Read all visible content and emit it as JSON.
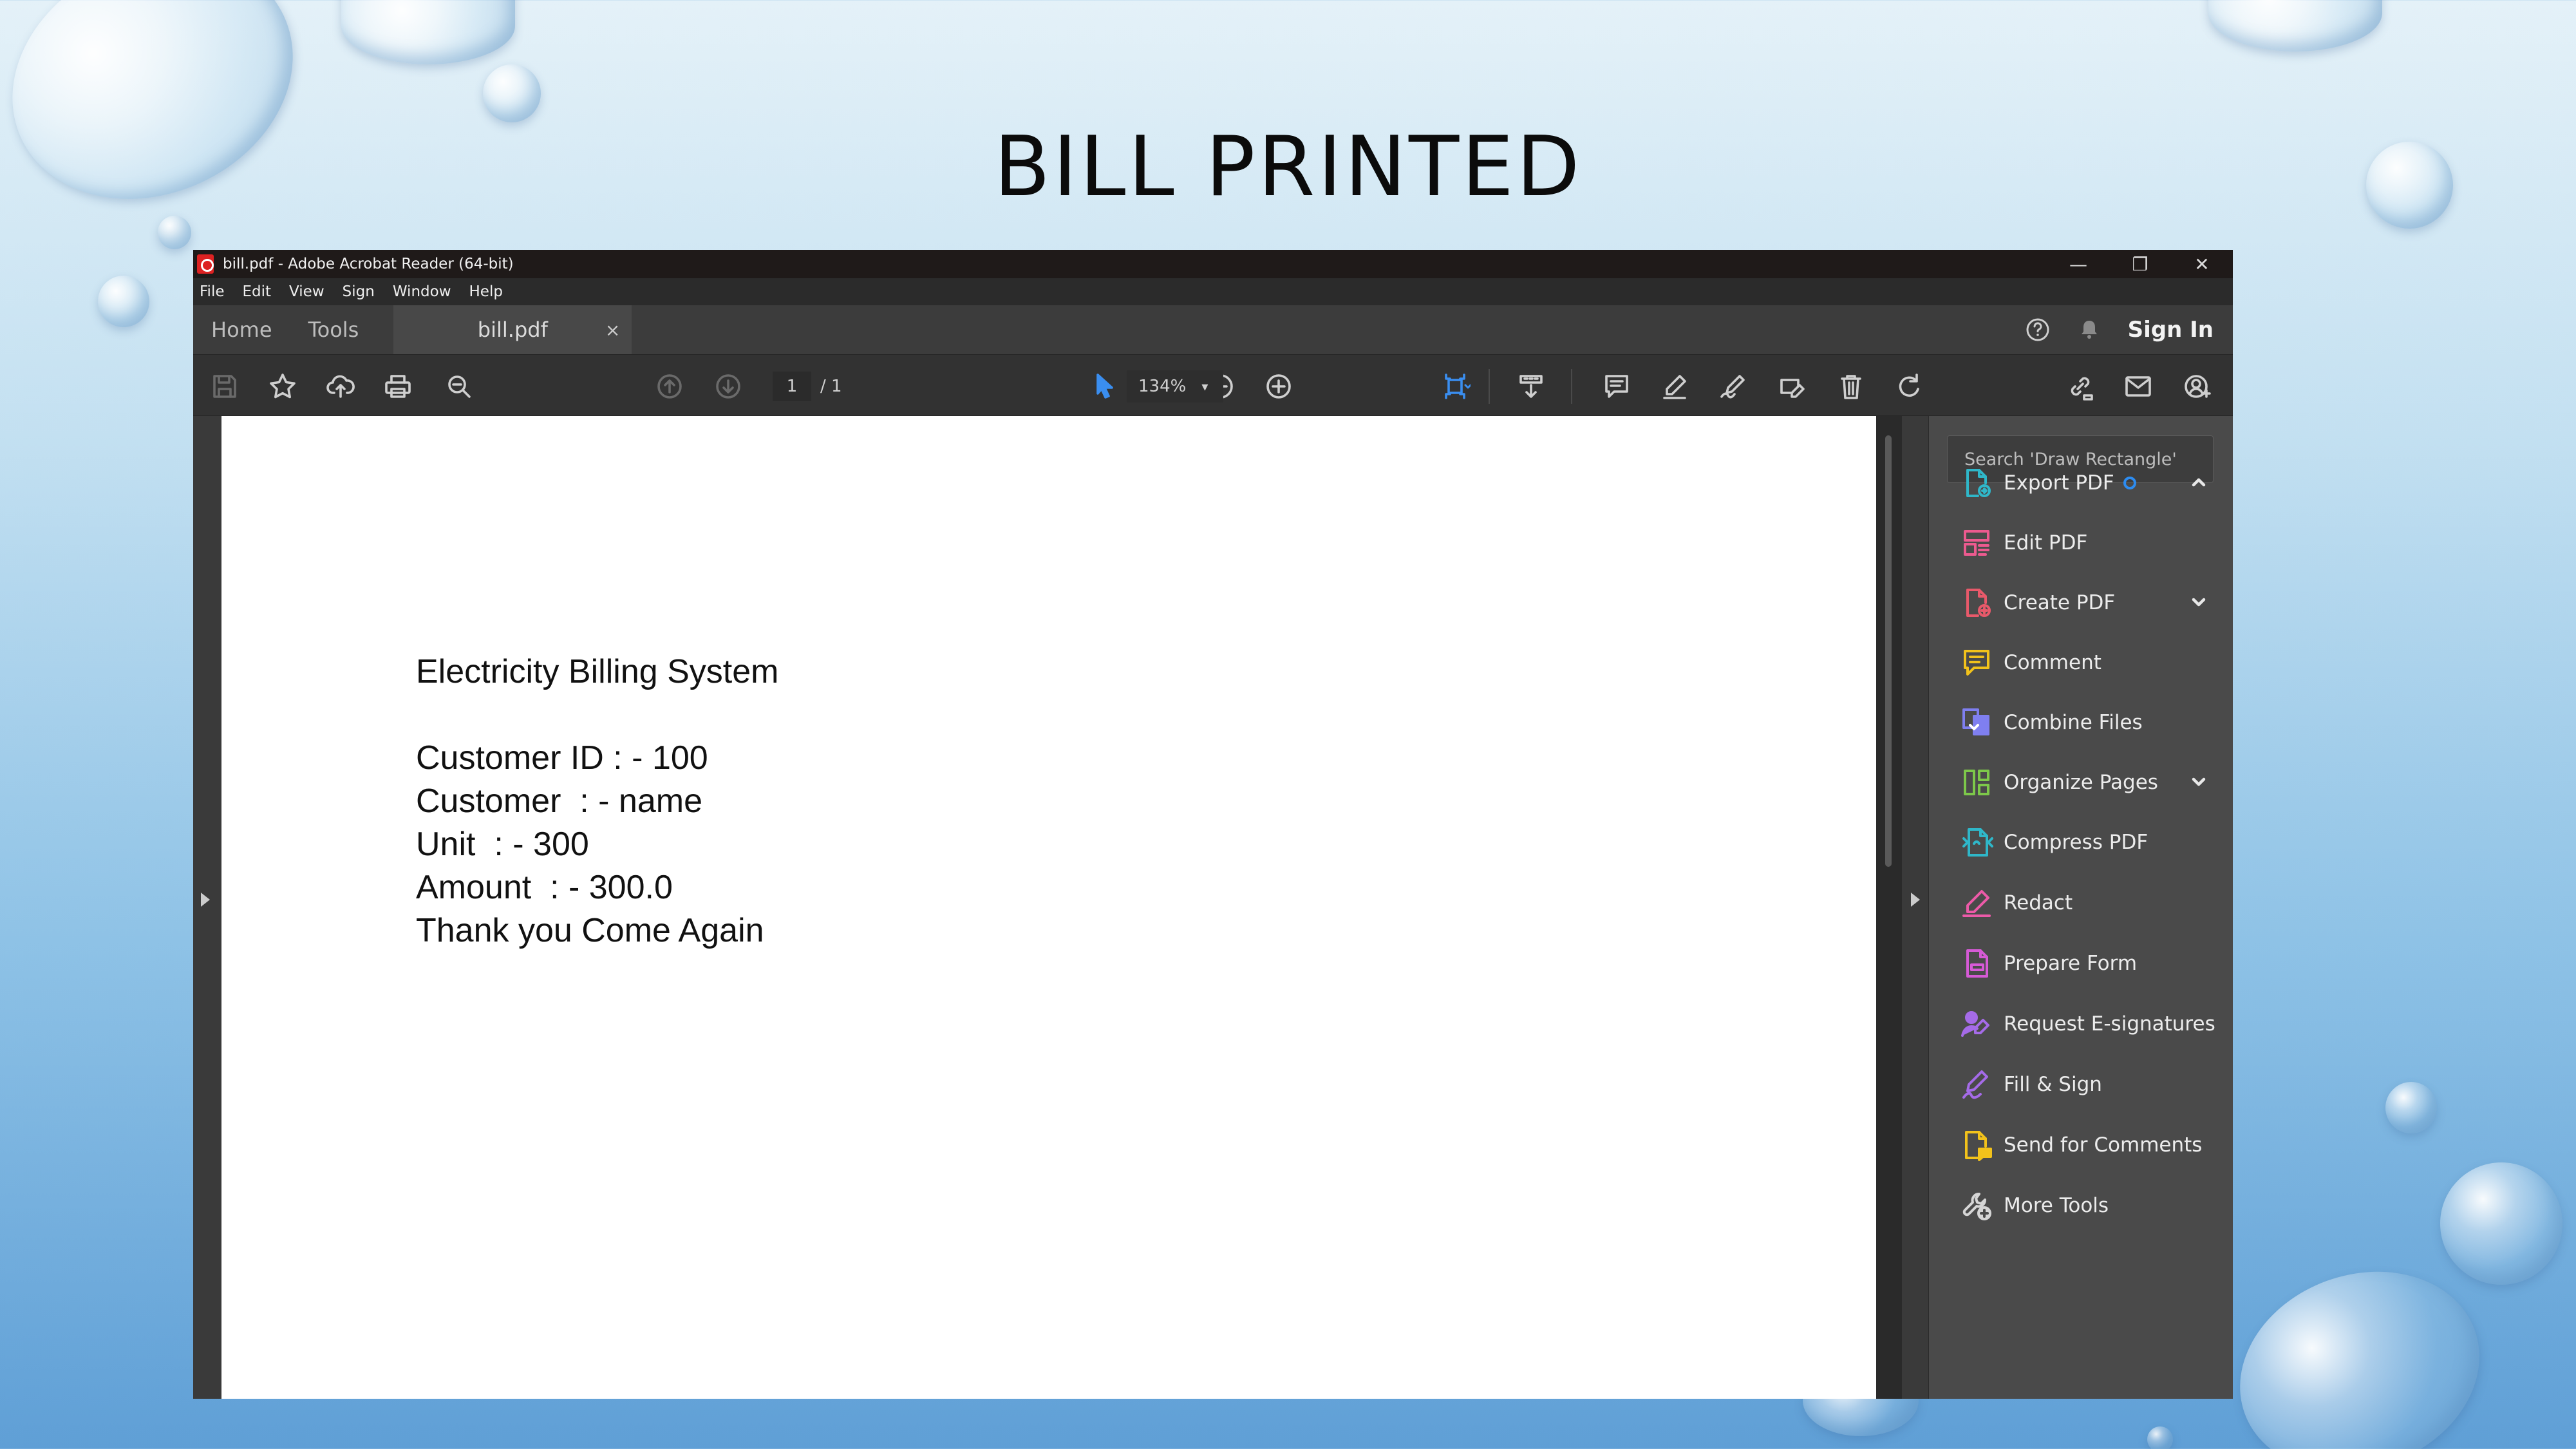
{
  "slide": {
    "title": "BILL PRINTED"
  },
  "window": {
    "title": "bill.pdf - Adobe Acrobat Reader (64-bit)",
    "controls": {
      "minimize": "—",
      "restore": "❐",
      "close": "✕"
    }
  },
  "menu": [
    "File",
    "Edit",
    "View",
    "Sign",
    "Window",
    "Help"
  ],
  "tabs": {
    "home": "Home",
    "tools": "Tools",
    "document": "bill.pdf",
    "close": "×"
  },
  "header_right": {
    "sign_in": "Sign In"
  },
  "toolbar": {
    "page_current": "1",
    "page_total": "/ 1",
    "zoom": "134%",
    "zoom_caret": "▾"
  },
  "document": {
    "lines": [
      "Electricity Billing System",
      "",
      "Customer ID : - 100",
      "Customer  : - name",
      "Unit  : - 300",
      "Amount  : - 300.0",
      "Thank you Come Again"
    ]
  },
  "tools_panel": {
    "search_placeholder": "Search 'Draw Rectangle'",
    "items": [
      {
        "label": "Export PDF",
        "icon": "export-pdf-icon",
        "color": "#2fb7c9"
      },
      {
        "label": "Edit PDF",
        "icon": "edit-pdf-icon",
        "color": "#ec5a8f"
      },
      {
        "label": "Create PDF",
        "icon": "create-pdf-icon",
        "color": "#e8596a"
      },
      {
        "label": "Comment",
        "icon": "comment-icon",
        "color": "#f2c21b"
      },
      {
        "label": "Combine Files",
        "icon": "combine-files-icon",
        "color": "#7f7ff0"
      },
      {
        "label": "Organize Pages",
        "icon": "organize-pages-icon",
        "color": "#7dc84a"
      },
      {
        "label": "Compress PDF",
        "icon": "compress-pdf-icon",
        "color": "#2fb7c9"
      },
      {
        "label": "Redact",
        "icon": "redact-icon",
        "color": "#ec5aa8"
      },
      {
        "label": "Prepare Form",
        "icon": "prepare-form-icon",
        "color": "#d65ad6"
      },
      {
        "label": "Request E-signatures",
        "icon": "request-esignatures-icon",
        "color": "#a56be8"
      },
      {
        "label": "Fill & Sign",
        "icon": "fill-sign-icon",
        "color": "#a56be8"
      },
      {
        "label": "Send for Comments",
        "icon": "send-for-comments-icon",
        "color": "#f2c21b"
      },
      {
        "label": "More Tools",
        "icon": "more-tools-icon",
        "color": "#d6d6d6"
      }
    ]
  },
  "colors": {
    "accent_blue": "#2d8cf0",
    "window_bg": "#323232",
    "panel_bg": "#4a4a4a"
  }
}
